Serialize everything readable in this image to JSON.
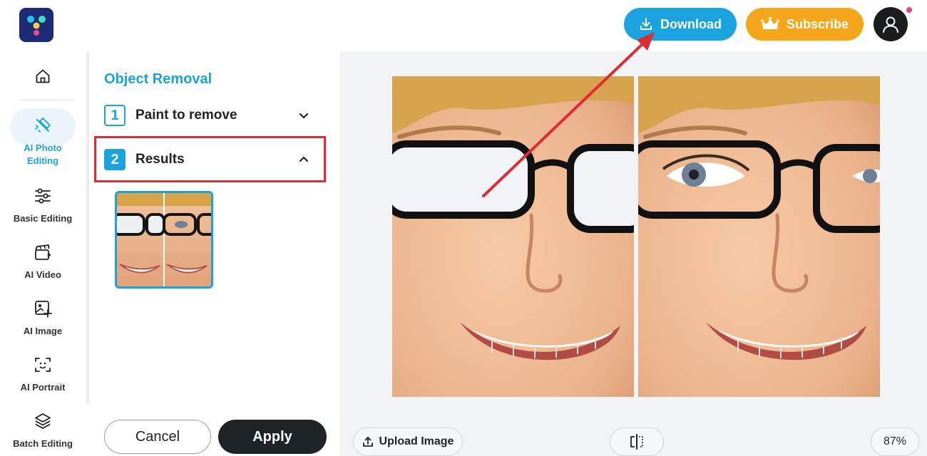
{
  "header": {
    "download_label": "Download",
    "subscribe_label": "Subscribe",
    "download_icon": "download-icon",
    "subscribe_icon": "crown-icon",
    "avatar_icon": "user-icon",
    "accent_color": "#1aa3df",
    "subscribe_color": "#f5a61a",
    "notification_dot_color": "#e0457a"
  },
  "sidebar": {
    "items": [
      {
        "label": "",
        "icon": "home-icon"
      },
      {
        "label": "AI Photo Editing",
        "icon": "magic-pen-icon",
        "active": true
      },
      {
        "label": "Basic Editing",
        "icon": "sliders-icon"
      },
      {
        "label": "AI Video",
        "icon": "clapperboard-icon"
      },
      {
        "label": "AI Image",
        "icon": "image-sparkle-icon"
      },
      {
        "label": "AI Portrait",
        "icon": "face-scan-icon"
      },
      {
        "label": "Batch Editing",
        "icon": "layers-icon"
      }
    ]
  },
  "panel": {
    "title": "Object Removal",
    "steps": [
      {
        "number": "1",
        "label": "Paint to remove",
        "expanded": false
      },
      {
        "number": "2",
        "label": "Results",
        "expanded": true
      }
    ],
    "cancel_label": "Cancel",
    "apply_label": "Apply"
  },
  "canvas": {
    "upload_label": "Upload Image",
    "upload_icon": "upload-icon",
    "compare_icon": "compare-split-icon",
    "zoom_level": "87%",
    "annotation_color": "#e02b35"
  }
}
